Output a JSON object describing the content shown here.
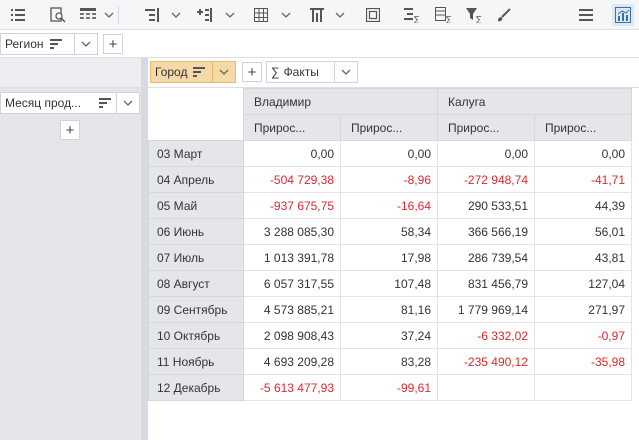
{
  "toolbar": {
    "icons": [
      "list-icon",
      "find-icon",
      "table-layout-icon",
      "row-indent-icon",
      "add-row-icon",
      "grid-icon",
      "column-icon",
      "frame-icon",
      "sum-rows-icon",
      "sum-cols-icon",
      "filter-sum-icon",
      "brush-icon",
      "menu-icon",
      "chart-icon"
    ]
  },
  "row_filter": {
    "label": "Регион"
  },
  "left_dim": {
    "label": "Месяц прод..."
  },
  "col_dim": {
    "label": "Город",
    "facts_symbol": "∑",
    "facts_label": "Факты"
  },
  "table": {
    "cities": [
      "Владимир",
      "Калуга"
    ],
    "sub_headers": [
      "Прирос...",
      "Прирос...",
      "Прирос...",
      "Прирос..."
    ],
    "rows": [
      {
        "label": "03 Март",
        "values": [
          "0,00",
          "0,00",
          "0,00",
          "0,00"
        ]
      },
      {
        "label": "04 Апрель",
        "values": [
          "-504 729,38",
          "-8,96",
          "-272 948,74",
          "-41,71"
        ]
      },
      {
        "label": "05 Май",
        "values": [
          "-937 675,75",
          "-16,64",
          "290 533,51",
          "44,39"
        ]
      },
      {
        "label": "06 Июнь",
        "values": [
          "3 288 085,30",
          "58,34",
          "366 566,19",
          "56,01"
        ]
      },
      {
        "label": "07 Июль",
        "values": [
          "1 013 391,78",
          "17,98",
          "286 739,54",
          "43,81"
        ]
      },
      {
        "label": "08 Август",
        "values": [
          "6 057 317,55",
          "107,48",
          "831 456,79",
          "127,04"
        ]
      },
      {
        "label": "09 Сентябрь",
        "values": [
          "4 573 885,21",
          "81,16",
          "1 779 969,14",
          "271,97"
        ]
      },
      {
        "label": "10 Октябрь",
        "values": [
          "2 098 908,43",
          "37,24",
          "-6 332,02",
          "-0,97"
        ]
      },
      {
        "label": "11 Ноябрь",
        "values": [
          "4 693 209,28",
          "83,28",
          "-235 490,12",
          "-35,98"
        ]
      },
      {
        "label": "12 Декабрь",
        "values": [
          "-5 613 477,93",
          "-99,61",
          "",
          ""
        ]
      }
    ]
  },
  "colors": {
    "negative": "#e0262d",
    "accent_chip": "#f7d9a8",
    "header_bg": "#e4e6ea"
  }
}
